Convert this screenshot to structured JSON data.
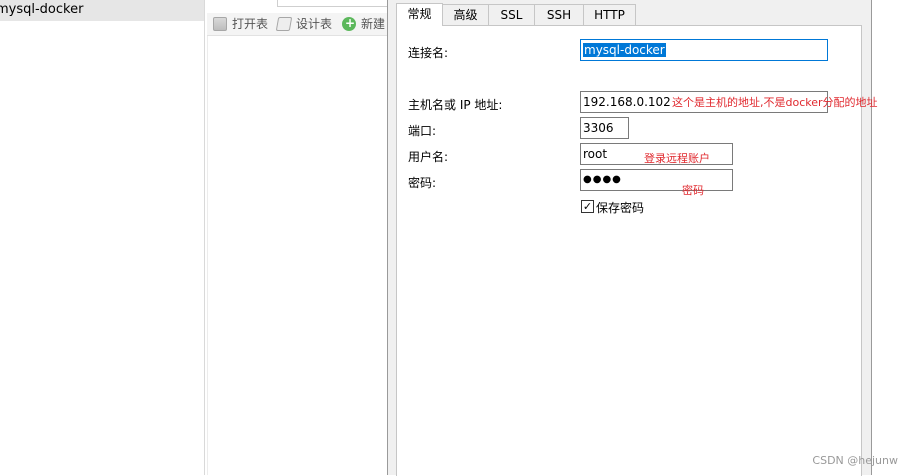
{
  "sidebar": {
    "connection_item": "mysql-docker"
  },
  "toolbar": {
    "open_table": "打开表",
    "design_table": "设计表",
    "new_table": "新建"
  },
  "dialog": {
    "tabs": [
      "常规",
      "高级",
      "SSL",
      "SSH",
      "HTTP"
    ],
    "active_tab": "常规",
    "form": {
      "connection_name_label": "连接名:",
      "connection_name_value": "mysql-docker",
      "host_label": "主机名或 IP 地址:",
      "host_value": "192.168.0.102",
      "port_label": "端口:",
      "port_value": "3306",
      "username_label": "用户名:",
      "username_value": "root",
      "password_label": "密码:",
      "password_value": "●●●●",
      "save_password_label": "保存密码",
      "save_password_checked": true
    },
    "annotations": {
      "host_note": "这个是主机的地址,不是docker分配的地址",
      "username_note": "登录远程账户",
      "password_note": "密码"
    }
  },
  "watermark": "CSDN @hejunw",
  "colors": {
    "selection": "#0078d7",
    "annotation": "#e0282e",
    "dialog_bg": "#f0f0f0"
  }
}
